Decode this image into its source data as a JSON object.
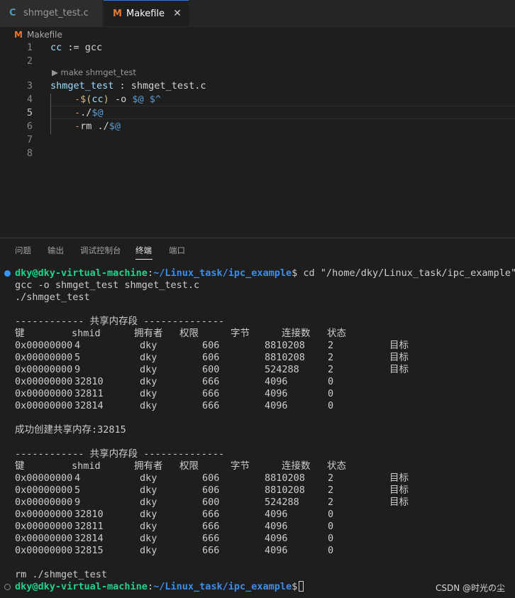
{
  "tabs": [
    {
      "icon": "C",
      "label": "shmget_test.c"
    },
    {
      "icon": "M",
      "label": "Makefile"
    }
  ],
  "tab_close_glyph": "✕",
  "breadcrumb": {
    "icon": "M",
    "label": "Makefile"
  },
  "editor": {
    "line_numbers": [
      "1",
      "2",
      "3",
      "4",
      "5",
      "6",
      "7",
      "8"
    ],
    "codelens": "▶ make shmget_test",
    "lines": {
      "l1": {
        "var": "cc",
        "op": " := ",
        "val": "gcc"
      },
      "l3": {
        "target": "shmget_test",
        "sep": " : ",
        "dep": "shmget_test.c"
      },
      "l4": {
        "dash": "-",
        "dollar1": "$(",
        "cc": "cc",
        "dollar2": ")",
        "mid": " -o ",
        "a1": "$@",
        "sp": " ",
        "a2": "$^"
      },
      "l5": {
        "dash": "-",
        "pre": "./",
        "a": "$@"
      },
      "l6": {
        "dash": "-",
        "pre": "rm ./",
        "a": "$@"
      }
    }
  },
  "panel_tabs": [
    "问题",
    "输出",
    "调试控制台",
    "终端",
    "端口"
  ],
  "terminal": {
    "prompt_user": "dky@dky-virtual-machine",
    "prompt_colon": ":",
    "prompt_path": "~/Linux_task/ipc_example",
    "prompt_dollar": "$",
    "cmd1": " cd \"/home/dky/Linux_task/ipc_example\" &",
    "line_gcc": "gcc -o shmget_test shmget_test.c",
    "line_run": "./shmget_test",
    "segment_title": "------------ 共享内存段 --------------",
    "headers": [
      "键",
      "shmid",
      "拥有者",
      "权限",
      "字节",
      "连接数",
      "状态"
    ],
    "table1": [
      [
        "0x00000000",
        "4",
        "dky",
        "606",
        "8810208",
        "2",
        "目标"
      ],
      [
        "0x00000000",
        "5",
        "dky",
        "606",
        "8810208",
        "2",
        "目标"
      ],
      [
        "0x00000000",
        "9",
        "dky",
        "600",
        "524288",
        "2",
        "目标"
      ],
      [
        "0x00000000",
        "32810",
        "dky",
        "666",
        "4096",
        "0",
        ""
      ],
      [
        "0x00000000",
        "32811",
        "dky",
        "666",
        "4096",
        "0",
        ""
      ],
      [
        "0x00000000",
        "32814",
        "dky",
        "666",
        "4096",
        "0",
        ""
      ]
    ],
    "success_msg": "成功创建共享内存:32815",
    "table2": [
      [
        "0x00000000",
        "4",
        "dky",
        "606",
        "8810208",
        "2",
        "目标"
      ],
      [
        "0x00000000",
        "5",
        "dky",
        "606",
        "8810208",
        "2",
        "目标"
      ],
      [
        "0x00000000",
        "9",
        "dky",
        "600",
        "524288",
        "2",
        "目标"
      ],
      [
        "0x00000000",
        "32810",
        "dky",
        "666",
        "4096",
        "0",
        ""
      ],
      [
        "0x00000000",
        "32811",
        "dky",
        "666",
        "4096",
        "0",
        ""
      ],
      [
        "0x00000000",
        "32814",
        "dky",
        "666",
        "4096",
        "0",
        ""
      ],
      [
        "0x00000000",
        "32815",
        "dky",
        "666",
        "4096",
        "0",
        ""
      ]
    ],
    "line_rm": "rm ./shmget_test"
  },
  "watermark": "CSDN @时光の尘",
  "colors": {
    "accent": "#3794ff",
    "prompt_user": "#23d18b",
    "prompt_path": "#3b8eea",
    "makefile_icon": "#e37933",
    "c_icon": "#519aba"
  }
}
